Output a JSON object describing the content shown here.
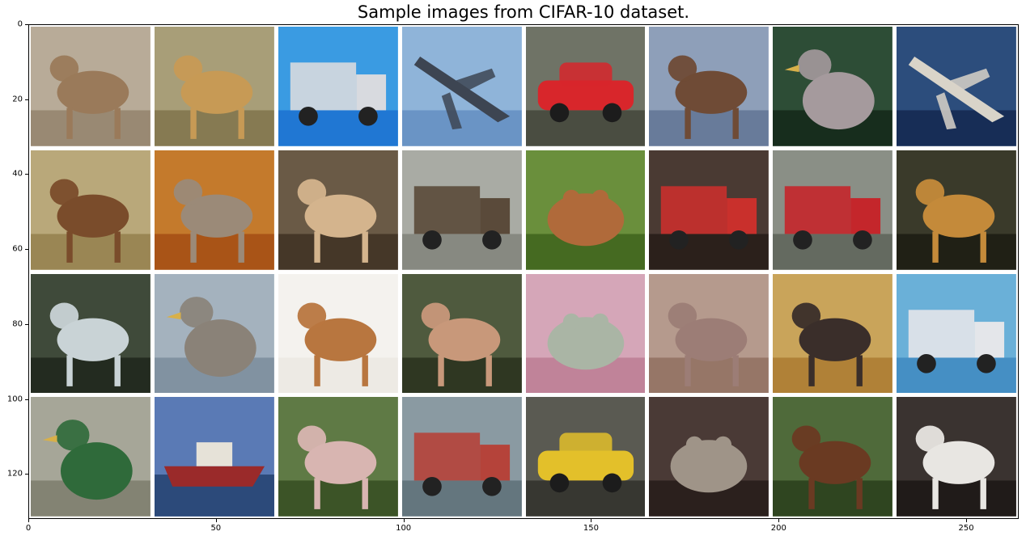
{
  "title": "Sample images from CIFAR-10 dataset.",
  "axes": {
    "xlim": [
      0,
      264
    ],
    "ylim": [
      0,
      132
    ],
    "x_ticks": [
      "0",
      "50",
      "100",
      "150",
      "200",
      "250"
    ],
    "y_ticks": [
      "0",
      "20",
      "40",
      "60",
      "80",
      "100",
      "120"
    ]
  },
  "grid": {
    "rows": 4,
    "cols": 8,
    "tiles": [
      {
        "subject": "deer",
        "bg": "#b8ab98",
        "fg": "#9a7a5a",
        "shape": "animal"
      },
      {
        "subject": "cat",
        "bg": "#a89e78",
        "fg": "#c79a55",
        "shape": "animal"
      },
      {
        "subject": "truck",
        "bg": "#3a9be2",
        "fg": "#d8dadf",
        "shape": "truck"
      },
      {
        "subject": "airplane",
        "bg": "#8fb4d9",
        "fg": "#3d4552",
        "shape": "plane"
      },
      {
        "subject": "car",
        "bg": "#6f7366",
        "fg": "#d8262b",
        "shape": "car"
      },
      {
        "subject": "horse",
        "bg": "#8e9fb9",
        "fg": "#6f4b36",
        "shape": "animal"
      },
      {
        "subject": "bird",
        "bg": "#2d4d36",
        "fg": "#a59a9d",
        "shape": "bird"
      },
      {
        "subject": "airplane",
        "bg": "#2c4d7c",
        "fg": "#d9d4c9",
        "shape": "plane"
      },
      {
        "subject": "horse",
        "bg": "#b9a87a",
        "fg": "#7a4c2b",
        "shape": "animal"
      },
      {
        "subject": "horse",
        "bg": "#c47a2c",
        "fg": "#9b8a78",
        "shape": "animal"
      },
      {
        "subject": "dog",
        "bg": "#6a5a46",
        "fg": "#d4b48d",
        "shape": "animal"
      },
      {
        "subject": "truck",
        "bg": "#a9aba4",
        "fg": "#5a4a3a",
        "shape": "truck"
      },
      {
        "subject": "frog",
        "bg": "#6a8f3c",
        "fg": "#b06a3a",
        "shape": "frog"
      },
      {
        "subject": "truck",
        "bg": "#4a3a33",
        "fg": "#c9302c",
        "shape": "truck"
      },
      {
        "subject": "truck",
        "bg": "#8a8f86",
        "fg": "#c4262b",
        "shape": "truck"
      },
      {
        "subject": "dog",
        "bg": "#3a3a2a",
        "fg": "#c48a3a",
        "shape": "animal"
      },
      {
        "subject": "deer",
        "bg": "#3f4a3a",
        "fg": "#c9d3d6",
        "shape": "animal"
      },
      {
        "subject": "bird",
        "bg": "#a4b2be",
        "fg": "#8a8278",
        "shape": "bird"
      },
      {
        "subject": "horse",
        "bg": "#f4f2ee",
        "fg": "#b8763f",
        "shape": "animal"
      },
      {
        "subject": "dog",
        "bg": "#4f5a3e",
        "fg": "#c8987a",
        "shape": "animal"
      },
      {
        "subject": "frog",
        "bg": "#d5a6b8",
        "fg": "#aab5a5",
        "shape": "frog"
      },
      {
        "subject": "deer",
        "bg": "#b59a8d",
        "fg": "#9c7d76",
        "shape": "animal"
      },
      {
        "subject": "cat",
        "bg": "#c9a45a",
        "fg": "#3a2e2a",
        "shape": "animal"
      },
      {
        "subject": "truck",
        "bg": "#6ab0d8",
        "fg": "#e4e6ea",
        "shape": "truck"
      },
      {
        "subject": "bird",
        "bg": "#a6a698",
        "fg": "#2f6a3a",
        "shape": "bird"
      },
      {
        "subject": "ship",
        "bg": "#5a7ab5",
        "fg": "#9a2a2a",
        "shape": "ship"
      },
      {
        "subject": "deer",
        "bg": "#5f7a45",
        "fg": "#d8b5b1",
        "shape": "animal"
      },
      {
        "subject": "truck",
        "bg": "#8a9aa2",
        "fg": "#b5433a",
        "shape": "truck"
      },
      {
        "subject": "car",
        "bg": "#5a5a52",
        "fg": "#e3c02a",
        "shape": "car"
      },
      {
        "subject": "frog",
        "bg": "#4a3a36",
        "fg": "#9f9488",
        "shape": "frog"
      },
      {
        "subject": "horse",
        "bg": "#4f6a3a",
        "fg": "#6a3a22",
        "shape": "animal"
      },
      {
        "subject": "cat",
        "bg": "#3a3330",
        "fg": "#e8e6e2",
        "shape": "animal"
      }
    ]
  }
}
